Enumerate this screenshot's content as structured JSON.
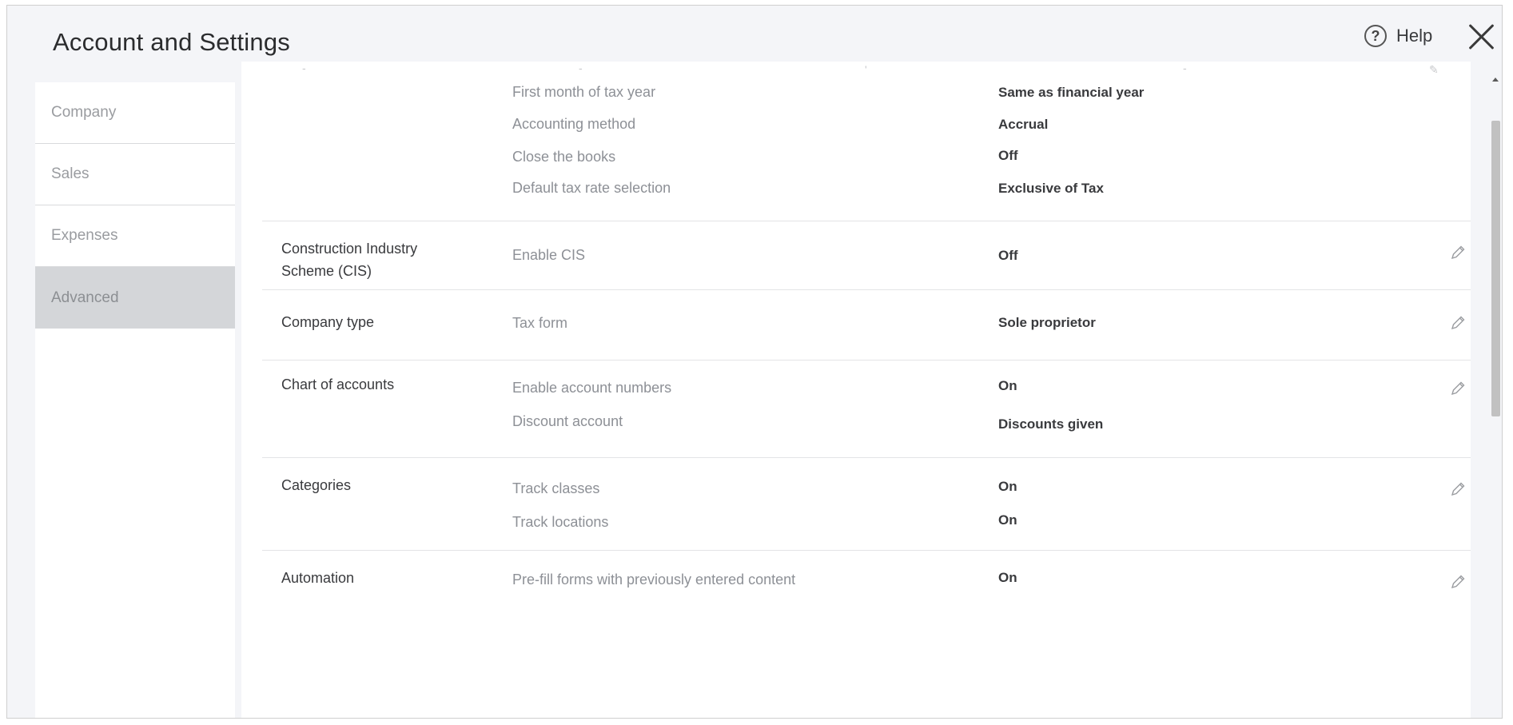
{
  "header": {
    "title": "Account and Settings",
    "help_label": "Help"
  },
  "sidebar": {
    "items": [
      {
        "label": "Company",
        "active": false
      },
      {
        "label": "Sales",
        "active": false
      },
      {
        "label": "Expenses",
        "active": false
      },
      {
        "label": "Advanced",
        "active": true
      }
    ]
  },
  "sections": [
    {
      "label": "",
      "settings": [
        {
          "name": "First month of tax year",
          "value": "Same as financial year"
        },
        {
          "name": "Accounting method",
          "value": "Accrual"
        },
        {
          "name": "Close the books",
          "value": "Off"
        },
        {
          "name": "Default tax rate selection",
          "value": "Exclusive of Tax"
        }
      ]
    },
    {
      "label": "Construction Industry Scheme (CIS)",
      "settings": [
        {
          "name": "Enable CIS",
          "value": "Off"
        }
      ]
    },
    {
      "label": "Company type",
      "settings": [
        {
          "name": "Tax form",
          "value": "Sole proprietor"
        }
      ]
    },
    {
      "label": "Chart of accounts",
      "settings": [
        {
          "name": "Enable account numbers",
          "value": "On"
        },
        {
          "name": "Discount account",
          "value": "Discounts given"
        }
      ]
    },
    {
      "label": "Categories",
      "settings": [
        {
          "name": "Track classes",
          "value": "On"
        },
        {
          "name": "Track locations",
          "value": "On"
        }
      ]
    },
    {
      "label": "Automation",
      "settings": [
        {
          "name": "Pre-fill forms with previously entered content",
          "value": "On"
        }
      ]
    }
  ],
  "icons": {
    "help": "help-circle-icon",
    "close": "close-icon",
    "edit": "pencil-icon"
  },
  "colors": {
    "background": "#f4f5f8",
    "active_tab": "#d4d6d9",
    "text": "#393a3d",
    "muted_text": "#8d9096"
  }
}
